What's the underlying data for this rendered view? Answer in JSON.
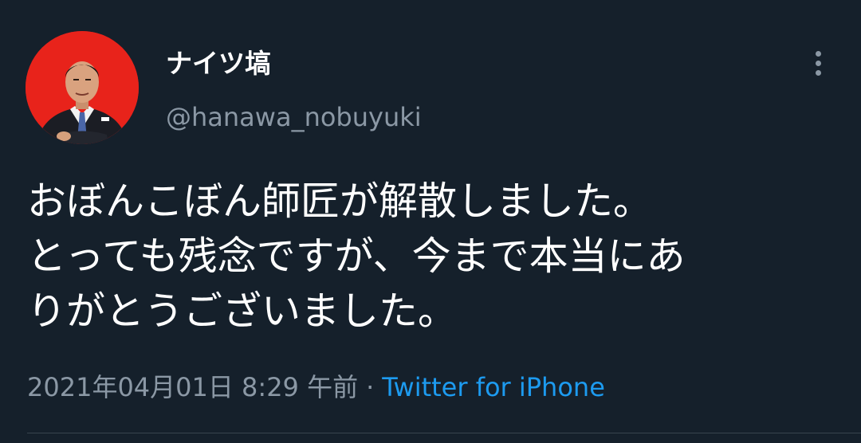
{
  "tweet": {
    "author": {
      "display_name": "ナイツ塙",
      "handle": "@hanawa_nobuyuki",
      "avatar_icon": "profile-photo-man-in-suit"
    },
    "more_icon": "vertical-ellipsis-icon",
    "text_lines": [
      "おぼんこぼん師匠が解散しました。",
      "とっても残念ですが、今まで本当にあ",
      "りがとうございました。"
    ],
    "timestamp": "2021年04月01日 8:29 午前",
    "separator": "·",
    "source": "Twitter for iPhone"
  },
  "colors": {
    "background": "#15202b",
    "text": "#ffffff",
    "secondary": "#8b98a5",
    "accent": "#1d9bf0",
    "avatar_bg": "#e8231b"
  }
}
